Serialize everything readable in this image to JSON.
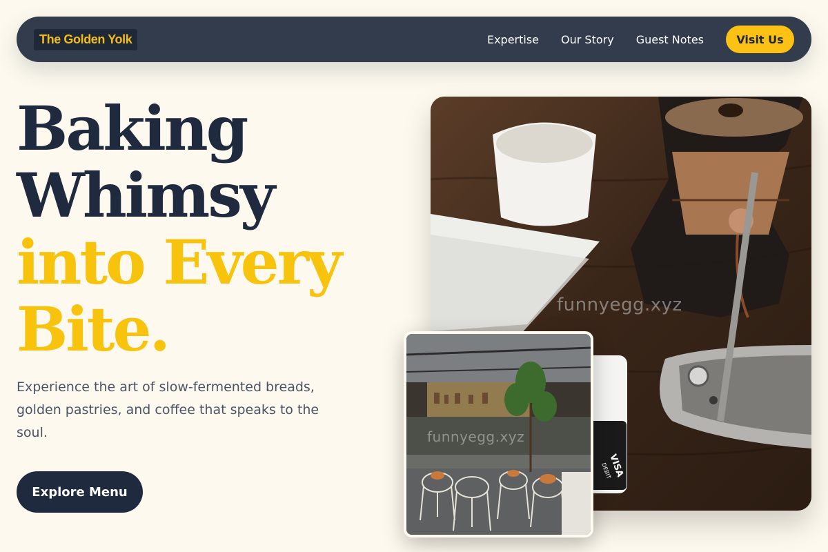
{
  "nav": {
    "logo": "The Golden Yolk",
    "links": [
      "Expertise",
      "Our Story",
      "Guest Notes"
    ],
    "cta": "Visit Us"
  },
  "hero": {
    "title_lines_dark": [
      "Baking",
      "Whimsy"
    ],
    "title_lines_gold": [
      "into Every",
      "Bite."
    ],
    "subtitle": "Experience the art of slow-fermented breads, golden pastries, and coffee that speaks to the soul.",
    "cta": "Explore Menu"
  },
  "images": {
    "main_watermark": "funnyegg.xyz",
    "small_watermark": "funnyegg.xyz",
    "card_text": "VISA",
    "card_subtext": "DEBIT"
  },
  "colors": {
    "background": "#fdf9ee",
    "navbar": "#323c4c",
    "accent": "#fbc114",
    "heading_dark": "#1f2a3f",
    "heading_gold": "#f7c30c"
  }
}
